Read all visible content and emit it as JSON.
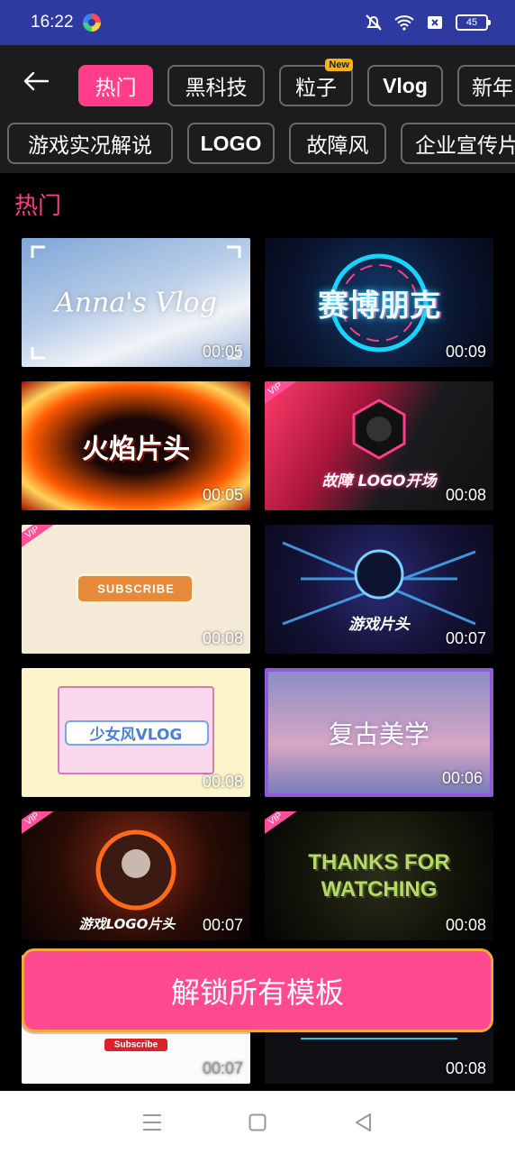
{
  "status": {
    "time": "16:22",
    "battery": "45",
    "icons": [
      "app-icon",
      "mute-icon",
      "wifi-icon",
      "sim-off-icon",
      "battery-icon"
    ]
  },
  "header": {
    "back_icon": "arrow-left-icon",
    "categories_row1": [
      {
        "label": "热门",
        "active": true
      },
      {
        "label": "黑科技",
        "active": false
      },
      {
        "label": "粒子",
        "active": false,
        "badge": "New"
      },
      {
        "label": "Vlog",
        "active": false
      },
      {
        "label": "新年",
        "active": false
      }
    ],
    "categories_row2": [
      {
        "label": "游戏实况解说",
        "active": false
      },
      {
        "label": "LOGO",
        "active": false
      },
      {
        "label": "故障风",
        "active": false
      },
      {
        "label": "企业宣传片",
        "active": false
      }
    ]
  },
  "section": {
    "title": "热门"
  },
  "templates": [
    {
      "art": "Anna's Vlog",
      "duration": "00:05",
      "vip": false
    },
    {
      "art": "赛博朋克",
      "duration": "00:09",
      "vip": false
    },
    {
      "art": "火焰片头",
      "duration": "00:05",
      "vip": false
    },
    {
      "art": "故障 LOGO开场",
      "duration": "00:08",
      "vip": true
    },
    {
      "art": "SUBSCRIBE",
      "duration": "00:08",
      "vip": true
    },
    {
      "art": "游戏片头",
      "duration": "00:07",
      "vip": false
    },
    {
      "art": "少女风VLOG",
      "duration": "00:08",
      "vip": false
    },
    {
      "art": "复古美学",
      "duration": "00:06",
      "vip": false
    },
    {
      "art": "游戏LOGO片头",
      "duration": "00:07",
      "vip": true
    },
    {
      "art": "THANKS FOR WATCHING",
      "duration": "00:08",
      "vip": true
    },
    {
      "art": "Subscribe",
      "duration": "00:07",
      "vip": false
    },
    {
      "art": "",
      "duration": "00:08",
      "vip": false
    }
  ],
  "vip_label": "VIP",
  "unlock": {
    "label": "解锁所有模板"
  },
  "nav": {
    "icons": [
      "menu-icon",
      "home-square-icon",
      "back-triangle-icon"
    ]
  }
}
